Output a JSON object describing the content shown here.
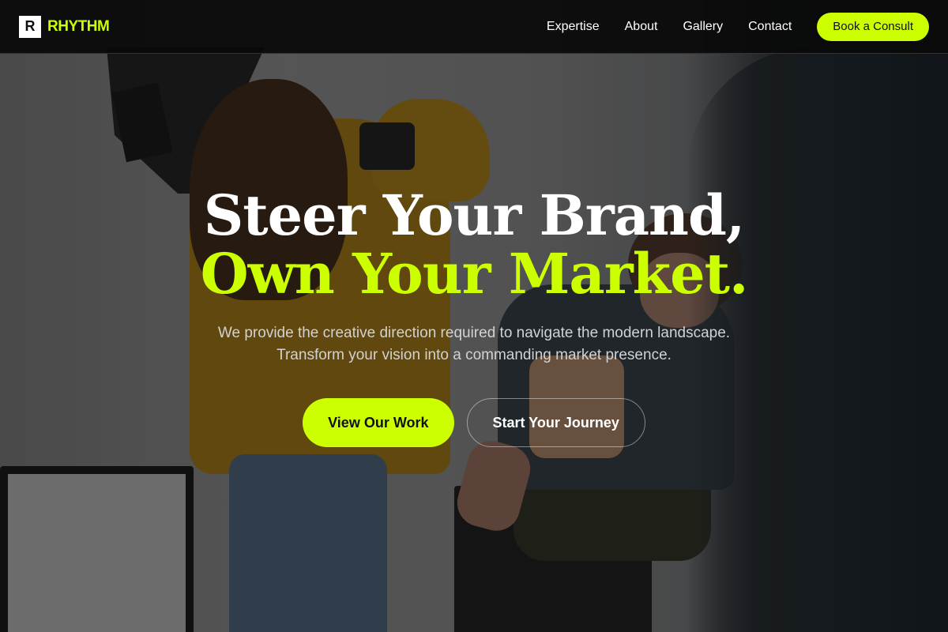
{
  "brand": {
    "logo_letter": "R",
    "name": "RHYTHM",
    "accent_color": "#ccff00"
  },
  "nav": {
    "items": [
      {
        "label": "Expertise"
      },
      {
        "label": "About"
      },
      {
        "label": "Gallery"
      },
      {
        "label": "Contact"
      }
    ],
    "cta_label": "Book a Consult"
  },
  "hero": {
    "headline_line1": "Steer Your Brand,",
    "headline_line2": "Own Your Market.",
    "subtext": "We provide the creative direction required to navigate the modern landscape. Transform your vision into a commanding market presence.",
    "primary_cta": "View Our Work",
    "secondary_cta": "Start Your Journey",
    "background_description_icon": "photo-studio-background"
  }
}
